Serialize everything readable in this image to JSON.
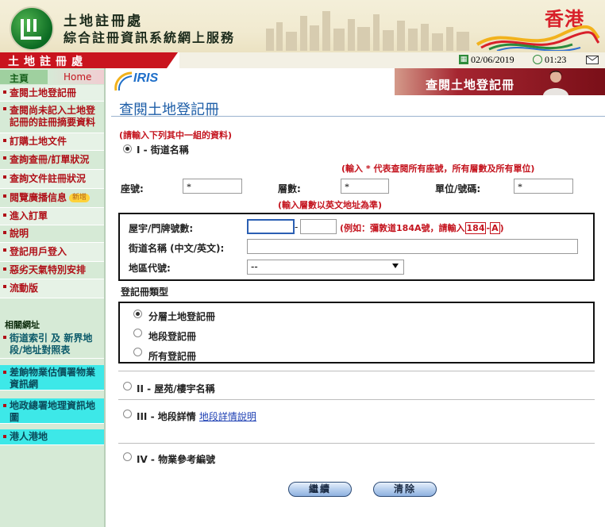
{
  "header": {
    "title_line1": "土地註冊處",
    "title_line2": "綜合註冊資訊系統網上服務",
    "brand": "香港"
  },
  "topbar": {
    "dept_name": "土地註冊處",
    "date": "02/06/2019",
    "time": "01:23"
  },
  "sidebar": {
    "home_label": "主頁",
    "home_link": "Home",
    "items": [
      {
        "label": "查閱土地登記冊"
      },
      {
        "label": "查閱尚未記入土地登記冊的註冊摘要資料"
      },
      {
        "label": "訂購土地文件"
      },
      {
        "label": "查詢查冊/訂單狀況"
      },
      {
        "label": "查詢文件註冊狀況"
      },
      {
        "label": "閱覽廣播信息",
        "badge": "新增"
      },
      {
        "label": "進入訂單"
      },
      {
        "label": "說明"
      },
      {
        "label": "登記用戶登入"
      },
      {
        "label": "惡劣天氣特別安排"
      },
      {
        "label": "流動版"
      }
    ],
    "related_label": "相關網址",
    "related": [
      {
        "label": "街道索引 及 新界地段/地址對照表"
      },
      {
        "label": "差餉物業估價署物業資訊網"
      },
      {
        "label": "地政總署地理資訊地圖"
      },
      {
        "label": "港人港地"
      }
    ]
  },
  "banner": {
    "logo_text": "IRIS",
    "title": "查閱土地登記冊"
  },
  "page": {
    "title": "查閱土地登記冊",
    "instruction": "(請輸入下列其中一組的資料)",
    "option1": "I - 街道名稱",
    "note_wildcard": "(輸入 * 代表查閱所有座號，所有層數及所有單位)",
    "block_label": "座號:",
    "block_value": "*",
    "floor_label": "層數:",
    "floor_value": "*",
    "unit_label": "單位/號碼:",
    "unit_value": "*",
    "note_floor": "(輸入層數以英文地址為準)",
    "street_no_label": "屋宇/門牌號數:",
    "street_no_from": "",
    "street_no_sep": "-",
    "street_no_to": "",
    "street_no_example_pre": "(例如：彌敦道184A號，請輸入",
    "street_no_example_1": "184",
    "street_no_example_sep": "-",
    "street_no_example_2": "A",
    "street_no_example_post": ")",
    "street_name_label": "街道名稱 (中文/英文):",
    "street_name_value": "",
    "district_label": "地區代號:",
    "district_value": "--",
    "register_type_label": "登記冊類型",
    "register_types": [
      "分層土地登記冊",
      "地段登記冊",
      "所有登記冊"
    ],
    "register_selected": 0,
    "option2": "II - 屋苑/樓宇名稱",
    "option3": "III - 地段詳情",
    "option3_link": "地段詳情說明",
    "option4": "IV - 物業參考編號",
    "continue_button": "繼續",
    "clear_button": "清除"
  }
}
